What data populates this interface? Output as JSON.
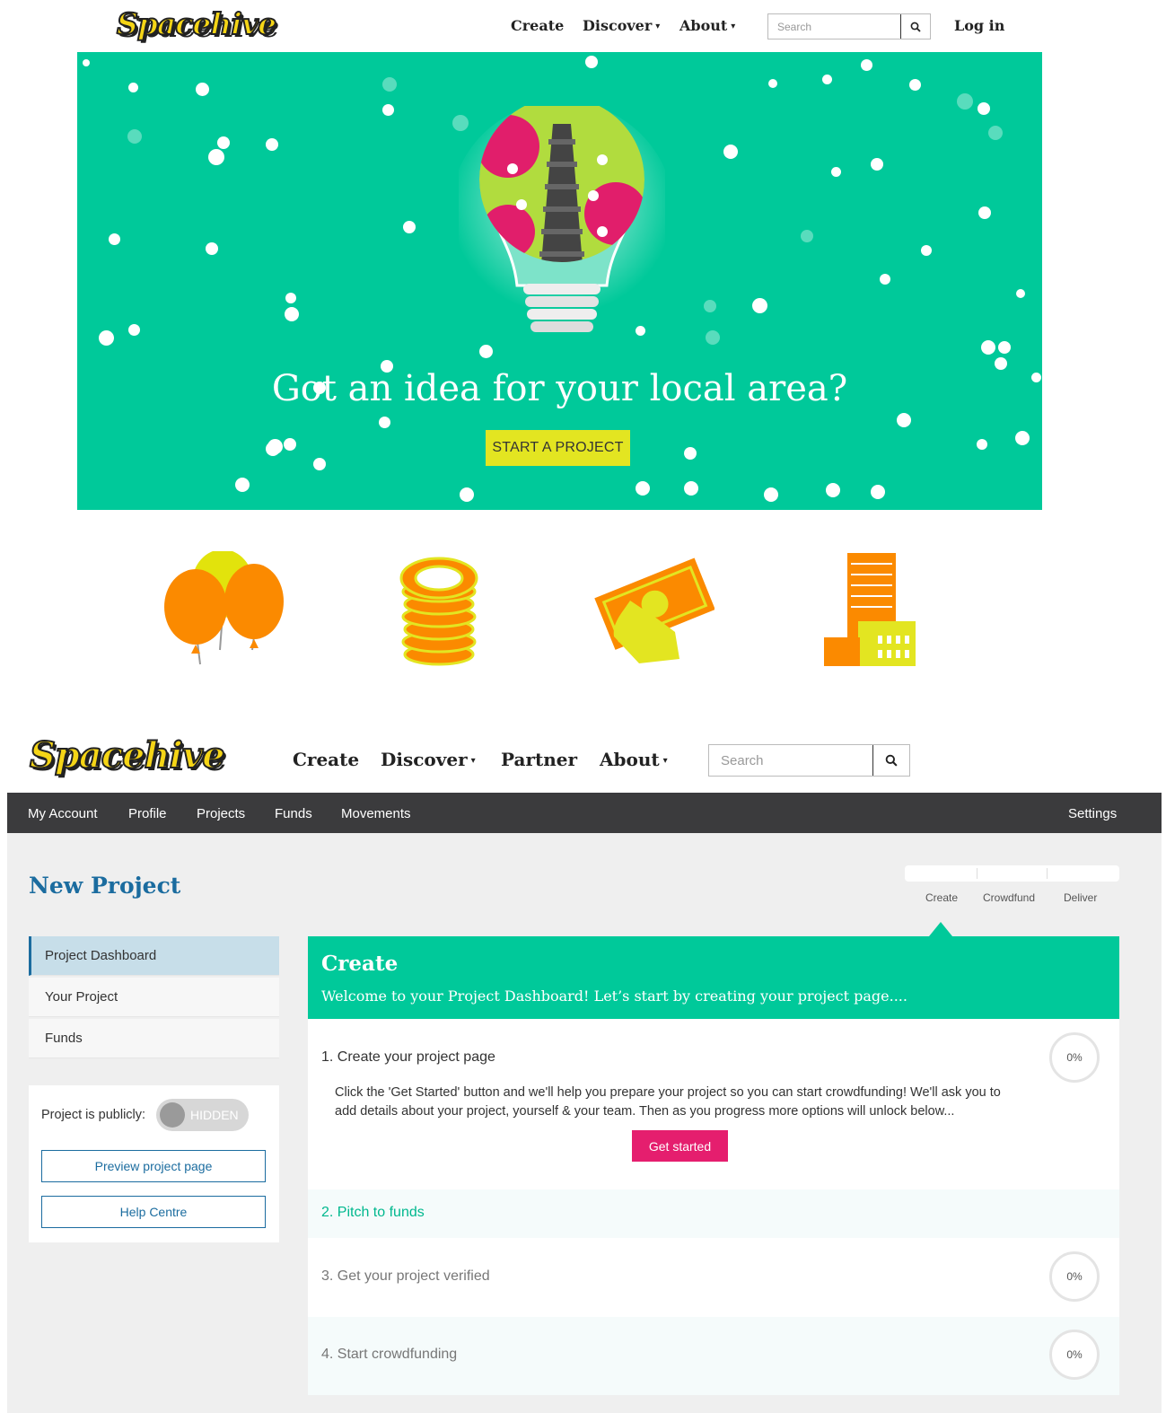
{
  "top": {
    "logo": "Spacehive",
    "nav": [
      "Create",
      "Discover",
      "About"
    ],
    "search_placeholder": "Search",
    "login": "Log in"
  },
  "hero": {
    "title": "Got an idea for your local area?",
    "cta": "START A PROJECT",
    "illustrations": [
      "lightbulb-icon"
    ],
    "background_color": "#00c99a",
    "cta_color": "#e3e521"
  },
  "feature_icons": [
    "balloons-icon",
    "coin-stack-icon",
    "banknote-hand-icon",
    "buildings-icon"
  ],
  "bottom": {
    "logo": "Spacehive",
    "nav": [
      "Create",
      "Discover",
      "Partner",
      "About"
    ],
    "search_placeholder": "Search",
    "subnav": [
      "My Account",
      "Profile",
      "Projects",
      "Funds",
      "Movements"
    ],
    "settings": "Settings",
    "page_title": "New Project",
    "stages": [
      "Create",
      "Crowdfund",
      "Deliver"
    ],
    "sidebar": [
      "Project Dashboard",
      "Your Project",
      "Funds"
    ],
    "publicity": {
      "label": "Project is publicly:",
      "toggle": "HIDDEN",
      "preview": "Preview project page",
      "help": "Help Centre"
    },
    "main": {
      "title": "Create",
      "subtitle": "Welcome to your Project Dashboard! Let’s start by creating your project page....",
      "steps": [
        {
          "title": "1. Create your project page",
          "progress": "0%",
          "description": "Click the 'Get Started' button and we'll help you prepare your project so you can start crowdfunding! We'll ask you to add details about your project, yourself & your team. Then as you progress more options will unlock below...",
          "button": "Get started"
        },
        {
          "title": "2. Pitch to funds"
        },
        {
          "title": "3. Get your project verified",
          "progress": "0%"
        },
        {
          "title": "4. Start crowdfunding",
          "progress": "0%"
        }
      ]
    },
    "colors": {
      "accent": "#00c99a",
      "primary": "#1b6c9f",
      "cta": "#e51e6e",
      "dark_bar": "#3b3b3d"
    }
  }
}
